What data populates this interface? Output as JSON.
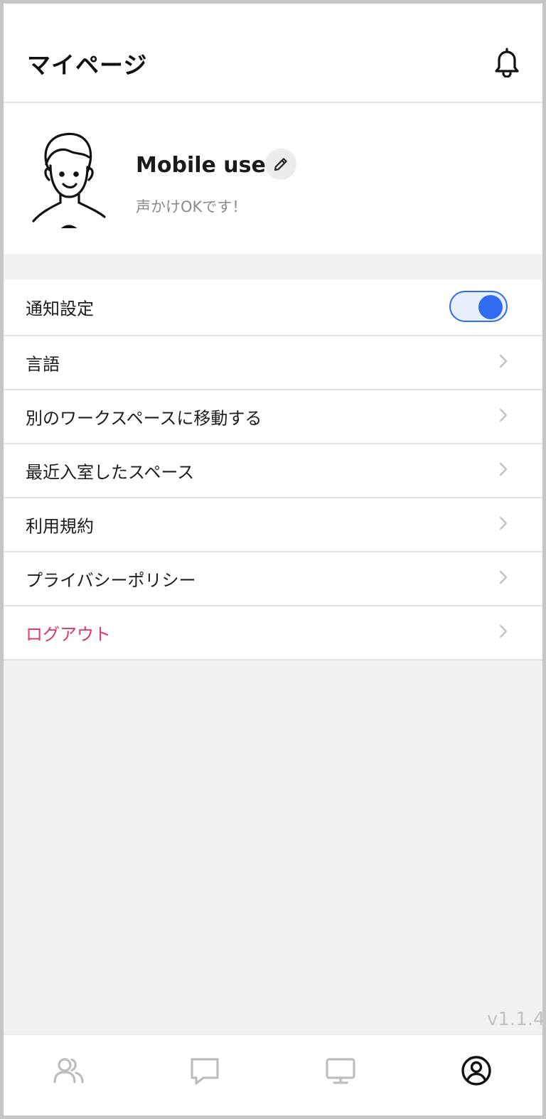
{
  "header": {
    "title": "マイページ",
    "bell_icon": "bell-icon"
  },
  "profile": {
    "name": "Mobile user",
    "status_message": "声かけOKです！",
    "avatar_icon": "person-illustration",
    "edit_icon": "pencil-icon"
  },
  "menu": {
    "items": [
      {
        "label": "通知設定",
        "type": "toggle",
        "on": true
      },
      {
        "label": "言語",
        "type": "link"
      },
      {
        "label": "別のワークスペースに移動する",
        "type": "link"
      },
      {
        "label": "最近入室したスペース",
        "type": "link"
      },
      {
        "label": "利用規約",
        "type": "link"
      },
      {
        "label": "プライバシーポリシー",
        "type": "link"
      },
      {
        "label": "ログアウト",
        "type": "link",
        "danger": true
      }
    ]
  },
  "version": "v1.1.4",
  "tabbar": {
    "tabs": [
      {
        "icon": "users-icon",
        "active": false
      },
      {
        "icon": "chat-bubble-icon",
        "active": false
      },
      {
        "icon": "monitor-icon",
        "active": false
      },
      {
        "icon": "user-circle-icon",
        "active": true
      }
    ]
  },
  "colors": {
    "accent": "#2f6cf0",
    "danger": "#e2385f",
    "background": "#f1f1f1",
    "inactive_icon": "#bdbdbd"
  }
}
